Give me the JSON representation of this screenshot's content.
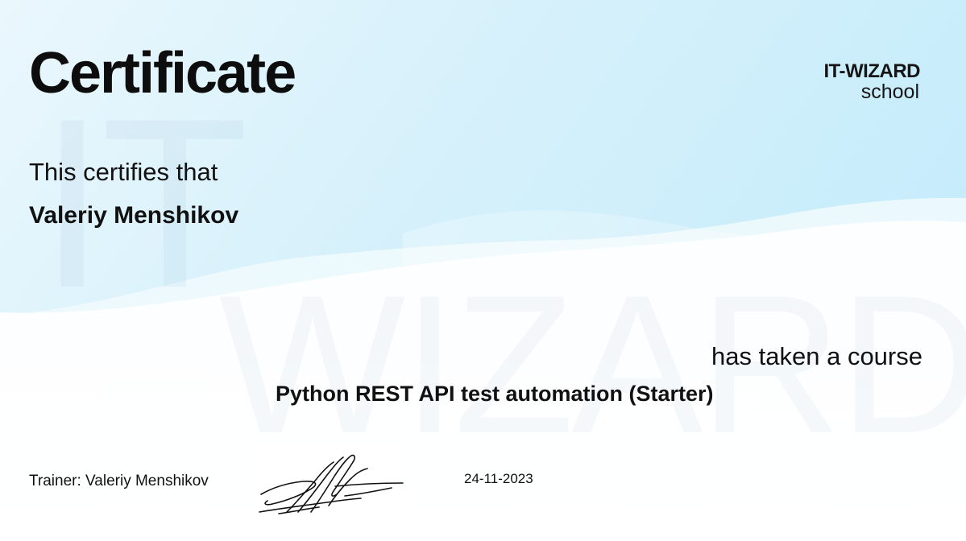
{
  "certificate": {
    "title": "Certificate",
    "logo": {
      "name": "IT-WIZARD",
      "subtitle": "school"
    },
    "watermark": {
      "line1": "IT",
      "line2": "WIZARD"
    },
    "certifies_text": "This certifies that",
    "recipient_name": "Valeriy Menshikov",
    "course_intro": "has taken a course",
    "course_name": "Python REST API test automation (Starter)",
    "trainer": "Trainer: Valeriy Menshikov",
    "date": "24-11-2023"
  },
  "colors": {
    "background_top": "#cdeffb",
    "background_bottom": "#ffffff",
    "text": "#111111"
  }
}
